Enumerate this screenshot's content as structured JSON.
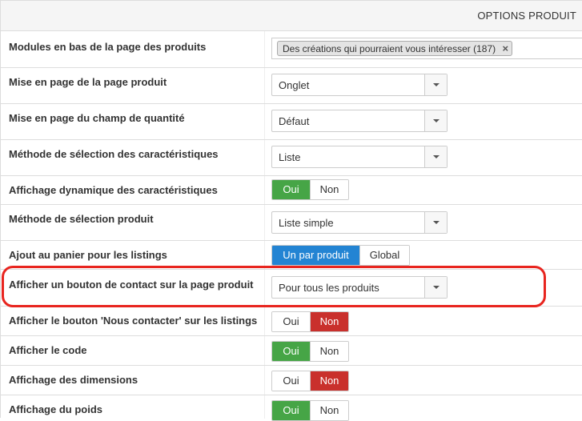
{
  "panel": {
    "title": "OPTIONS PRODUIT"
  },
  "rows": {
    "modules": {
      "label": "Modules en bas de la page des produits",
      "tag": "Des créations qui pourraient vous intéresser (187)",
      "tag_remove": "×"
    },
    "layout_page": {
      "label": "Mise en page de la page produit",
      "value": "Onglet"
    },
    "layout_quantity": {
      "label": "Mise en page du champ de quantité",
      "value": "Défaut"
    },
    "feature_selection": {
      "label": "Méthode de sélection des caractéristiques",
      "value": "Liste"
    },
    "dynamic_features": {
      "label": "Affichage dynamique des caractéristiques",
      "yes": "Oui",
      "no": "Non",
      "selected": "yes"
    },
    "product_selection": {
      "label": "Méthode de sélection produit",
      "value": "Liste simple"
    },
    "add_to_cart": {
      "label": "Ajout au panier pour les listings",
      "option_one": "Un par produit",
      "option_global": "Global",
      "selected": "option_one"
    },
    "contact_button": {
      "label": "Afficher un bouton de contact sur la page produit",
      "value": "Pour tous les produits"
    },
    "contact_listing": {
      "label": "Afficher le bouton 'Nous contacter' sur les listings",
      "yes": "Oui",
      "no": "Non",
      "selected": "no"
    },
    "show_code": {
      "label": "Afficher le code",
      "yes": "Oui",
      "no": "Non",
      "selected": "yes"
    },
    "show_dimensions": {
      "label": "Affichage des dimensions",
      "yes": "Oui",
      "no": "Non",
      "selected": "no"
    },
    "show_weight": {
      "label": "Affichage du poids",
      "yes": "Oui",
      "no": "Non",
      "selected": "yes"
    }
  },
  "colors": {
    "yes_active": "#46a546",
    "no_active": "#c9302c",
    "primary_active": "#2384d3",
    "highlight": "#e8251f"
  }
}
